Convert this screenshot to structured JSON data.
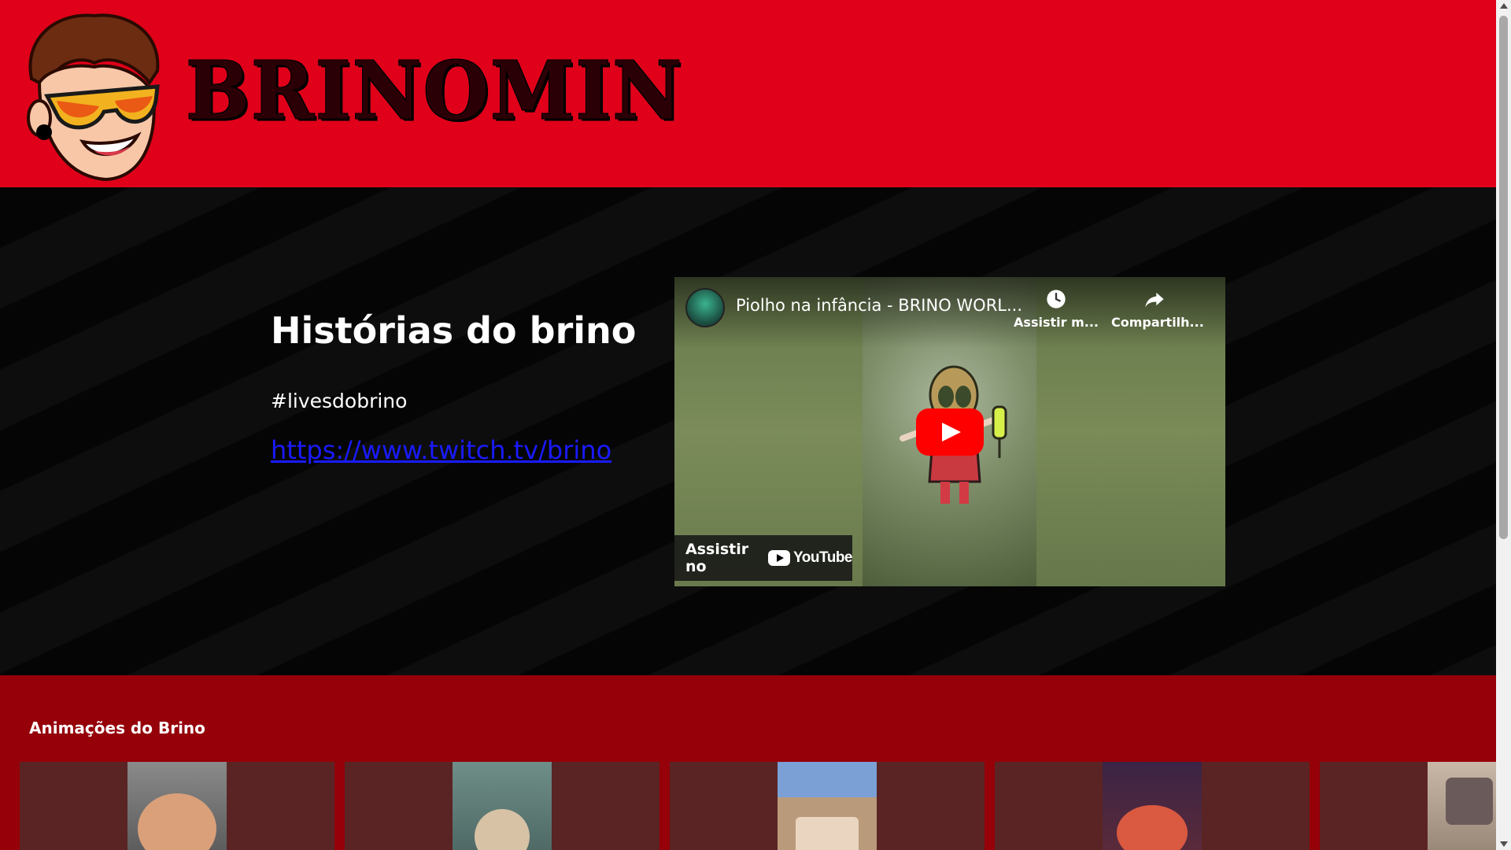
{
  "header": {
    "brand": "BRINOMIN",
    "avatar_icon": "brino-avatar-icon",
    "background_color": "#e0001a"
  },
  "hero": {
    "title": "Histórias do brino",
    "tag": "#livesdobrino",
    "link": "https://www.twitch.tv/brino"
  },
  "video": {
    "title": "Piolho na infância - BRINO WORL...",
    "watch_later_label": "Assistir m...",
    "share_label": "Compartilh...",
    "watch_on_label": "Assistir no",
    "youtube_label": "YouTube"
  },
  "animations": {
    "title": "Animações do Brino",
    "background_color": "#950009",
    "thumbnails": [
      {
        "name": "thumb-1",
        "accent": "#8a8a8a"
      },
      {
        "name": "thumb-2",
        "accent": "#6f8e88"
      },
      {
        "name": "thumb-3",
        "accent": "#7aa0d6"
      },
      {
        "name": "thumb-4",
        "accent": "#3a2445"
      },
      {
        "name": "thumb-5",
        "accent": "#c9b8a8"
      }
    ]
  }
}
